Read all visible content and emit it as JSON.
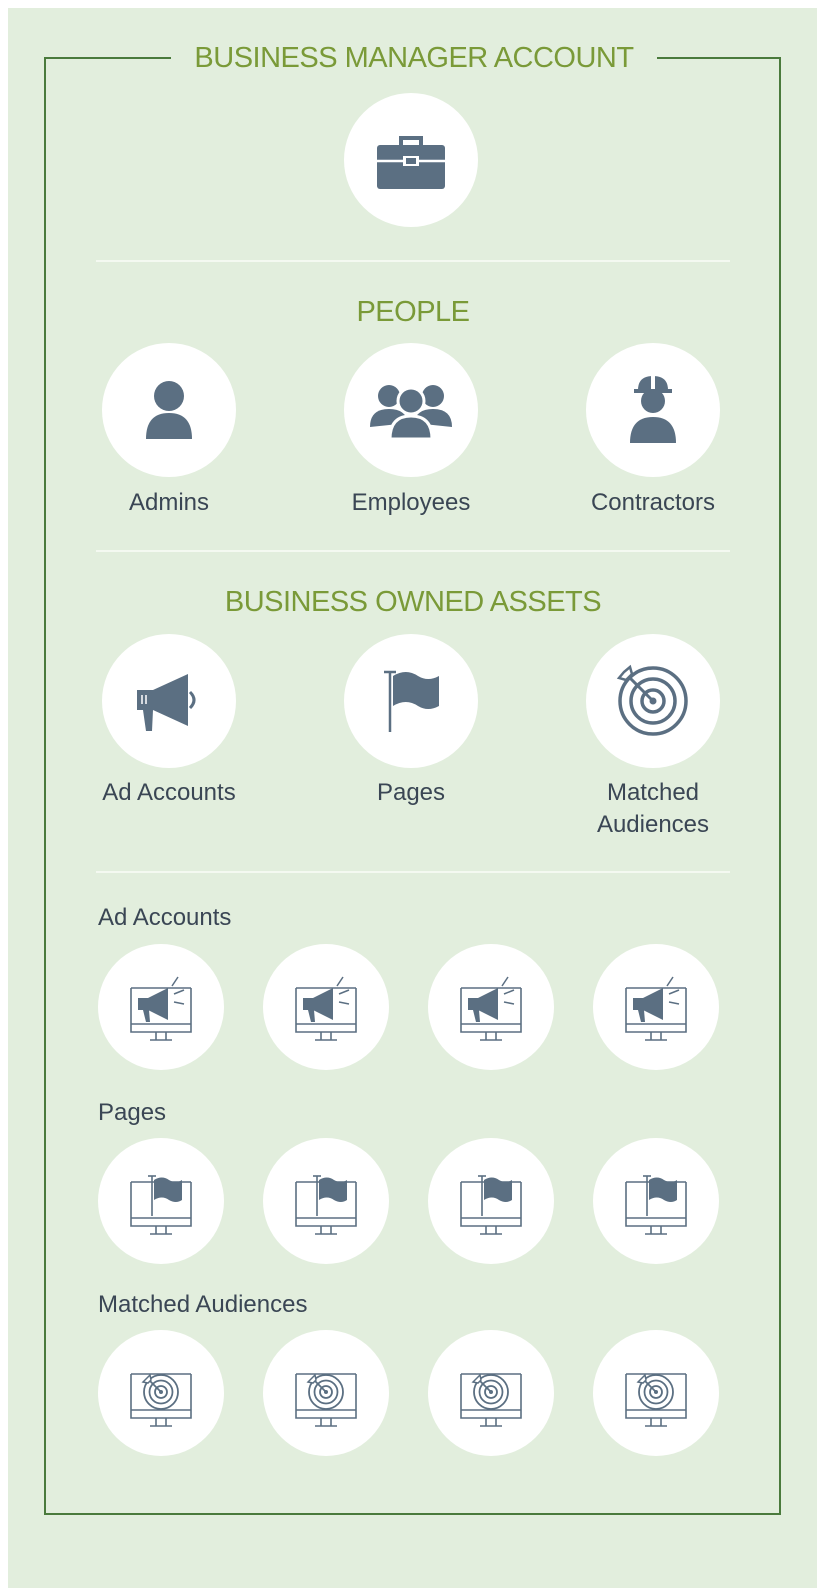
{
  "title": "BUSINESS MANAGER ACCOUNT",
  "root_icon": "briefcase-icon",
  "people": {
    "title": "PEOPLE",
    "items": [
      {
        "label": "Admins",
        "icon": "user-icon"
      },
      {
        "label": "Employees",
        "icon": "group-icon"
      },
      {
        "label": "Contractors",
        "icon": "hardhat-worker-icon"
      }
    ]
  },
  "assets": {
    "title": "BUSINESS OWNED ASSETS",
    "items": [
      {
        "label": "Ad Accounts",
        "icon": "megaphone-icon"
      },
      {
        "label": "Pages",
        "icon": "flag-icon"
      },
      {
        "label_line1": "Matched",
        "label_line2": "Audiences",
        "icon": "target-icon"
      }
    ]
  },
  "lists": [
    {
      "label": "Ad Accounts",
      "icon": "monitor-megaphone-icon",
      "count": 4
    },
    {
      "label": "Pages",
      "icon": "monitor-flag-icon",
      "count": 4
    },
    {
      "label": "Matched Audiences",
      "icon": "monitor-target-icon",
      "count": 4
    }
  ],
  "colors": {
    "background": "#e2eedd",
    "frame": "#4a7a3c",
    "heading": "#7a9a38",
    "icon": "#5b6f82",
    "circle": "#ffffff",
    "text": "#3a4654"
  }
}
